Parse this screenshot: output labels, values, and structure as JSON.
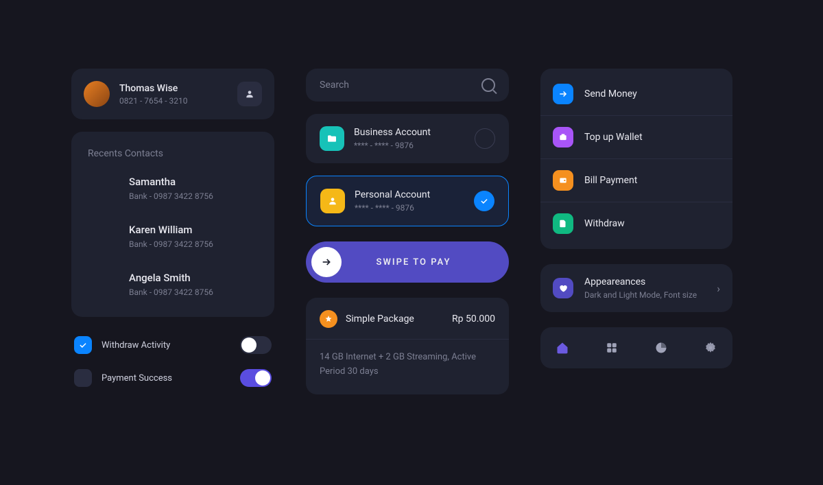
{
  "profile": {
    "name": "Thomas Wise",
    "phone": "0821 - 7654 - 3210"
  },
  "contacts": {
    "title": "Recents Contacts",
    "items": [
      {
        "name": "Samantha",
        "sub": "Bank - 0987 3422 8756"
      },
      {
        "name": "Karen William",
        "sub": "Bank - 0987 3422 8756"
      },
      {
        "name": "Angela Smith",
        "sub": "Bank - 0987 3422 8756"
      }
    ]
  },
  "toggles": [
    {
      "label": "Withdraw Activity",
      "checked": true,
      "switch_on": false
    },
    {
      "label": "Payment Success",
      "checked": false,
      "switch_on": true
    }
  ],
  "search": {
    "placeholder": "Search"
  },
  "accounts": [
    {
      "name": "Business Account",
      "number": "**** - **** - 9876",
      "selected": false
    },
    {
      "name": "Personal Account",
      "number": "**** - **** - 9876",
      "selected": true
    }
  ],
  "swipe": {
    "label": "SWIPE TO PAY"
  },
  "package": {
    "name": "Simple Package",
    "price": "Rp 50.000",
    "desc": "14 GB Internet + 2 GB Streaming, Active Period 30 days"
  },
  "actions": [
    {
      "label": "Send Money",
      "color": "blue"
    },
    {
      "label": "Top up Wallet",
      "color": "purple"
    },
    {
      "label": "Bill Payment",
      "color": "orange"
    },
    {
      "label": "Withdraw",
      "color": "green"
    }
  ],
  "appearances": {
    "title": "Appeareances",
    "sub": "Dark and Light Mode, Font size"
  },
  "nav": {
    "items": [
      "home",
      "grid",
      "chart",
      "settings"
    ],
    "active": "home"
  }
}
